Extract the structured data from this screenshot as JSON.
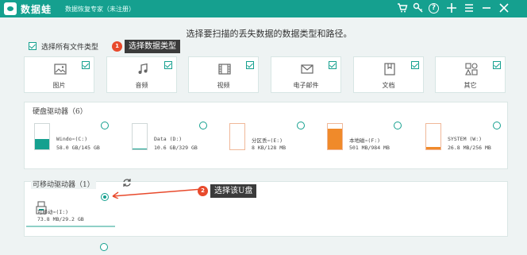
{
  "titlebar": {
    "app_name": "数据蛙",
    "subtitle": "数据恢复专家（未注册）",
    "icons": [
      "cart-icon",
      "key-icon",
      "help-icon",
      "plus-icon",
      "menu-icon",
      "minimize-icon",
      "close-icon"
    ],
    "help_glyph": "?"
  },
  "prompt": "选择要扫描的丢失数据的数据类型和路径。",
  "select_all": {
    "label": "选择所有文件类型",
    "checked": true
  },
  "callout1": {
    "badge": "1",
    "text": "选择数据类型"
  },
  "callout2": {
    "badge": "2",
    "text": "选择该U盘"
  },
  "file_types": [
    {
      "label": "图片",
      "icon": "image-icon",
      "checked": true
    },
    {
      "label": "音频",
      "icon": "music-icon",
      "checked": true
    },
    {
      "label": "视频",
      "icon": "video-icon",
      "checked": true
    },
    {
      "label": "电子邮件",
      "icon": "email-icon",
      "checked": true
    },
    {
      "label": "文档",
      "icon": "document-icon",
      "checked": true
    },
    {
      "label": "其它",
      "icon": "other-icon",
      "checked": true
    }
  ],
  "hard_drives": {
    "title": "硬盘驱动器（6）",
    "items": [
      {
        "name": "Windo⋯(C:)",
        "size": "58.0 GB/145 GB",
        "fill_percent": 40,
        "fill_color": "#15a08f"
      },
      {
        "name": "Data (D:)",
        "size": "10.6 GB/329 GB",
        "fill_percent": 3,
        "fill_color": "#15a08f"
      },
      {
        "name": "分区丢⋯(E:)",
        "size": "8 KB/128 MB",
        "fill_percent": 0,
        "fill_color": "#f0a070"
      },
      {
        "name": "本地磁⋯(F:)",
        "size": "501 MB/984 MB",
        "fill_percent": 80,
        "fill_color": "#f08a2a"
      },
      {
        "name": "SYSTEM (W:)",
        "size": "26.8 MB/256 MB",
        "fill_percent": 10,
        "fill_color": "#f08a2a"
      }
    ]
  },
  "removable": {
    "title": "可移动驱动器（1）",
    "items": [
      {
        "name": "可移动⋯(I:)",
        "size": "73.8 MB/29.2 GB",
        "selected": true
      }
    ]
  },
  "colors": {
    "accent": "#15a08f",
    "callout_badge": "#e84a2c",
    "callout_bg": "#3b3b3b",
    "arrow": "#e84a2c"
  }
}
